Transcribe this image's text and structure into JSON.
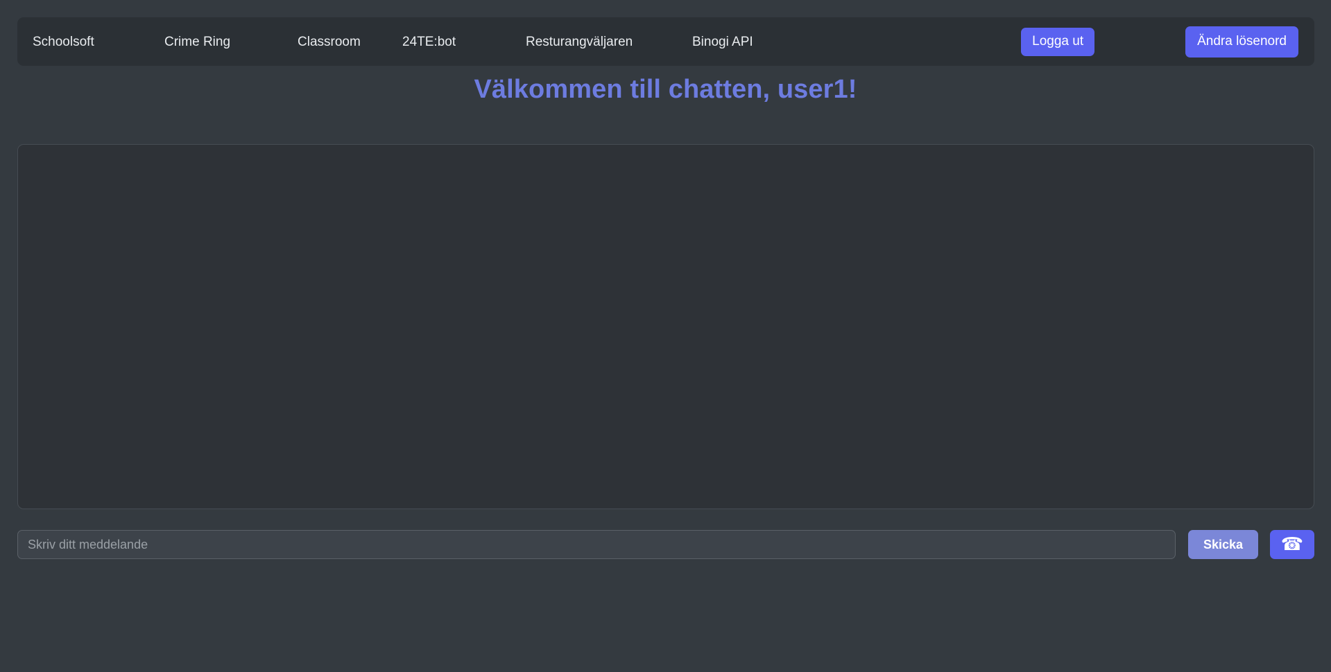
{
  "navbar": {
    "links": [
      {
        "label": "Schoolsoft"
      },
      {
        "label": "Crime Ring"
      },
      {
        "label": "Classroom"
      },
      {
        "label": "24TE:bot"
      },
      {
        "label": "Resturangväljaren"
      },
      {
        "label": "Binogi API"
      }
    ],
    "logout_label": "Logga ut",
    "change_password_label": "Ändra lösenord"
  },
  "main": {
    "title": "Välkommen till chatten, user1!",
    "chat_messages": []
  },
  "composer": {
    "input_value": "",
    "input_placeholder": "Skriv ditt meddelande",
    "send_label": "Skicka",
    "call_icon": "☎"
  },
  "colors": {
    "page_background": "#343a40",
    "navbar_background": "#2b3035",
    "chat_background": "#2e3237",
    "accent_indigo": "#5a62f0",
    "send_button": "#7b87d8",
    "heading_blue": "#6d7ce0",
    "input_background": "#3d434a",
    "nav_text": "#e9ecef",
    "placeholder_text": "#9aa0a6"
  }
}
